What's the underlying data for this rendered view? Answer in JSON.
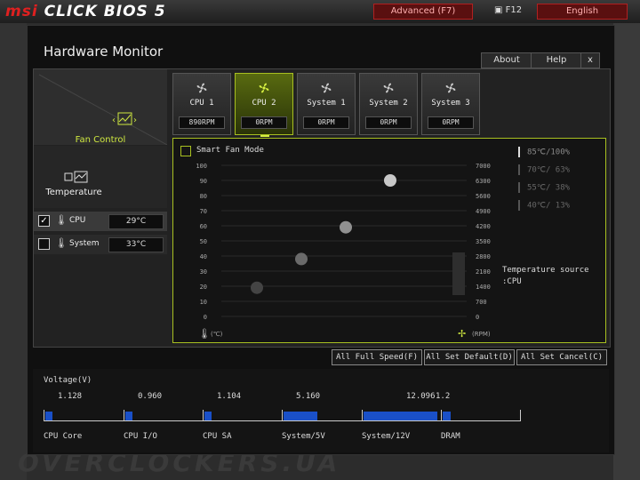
{
  "topbar": {
    "brand_msi": "msi",
    "brand_rest": "CLICK BIOS 5",
    "mode": "Advanced (F7)",
    "screenshot_key": "F12",
    "language": "English"
  },
  "window": {
    "title": "Hardware Monitor",
    "about": "About",
    "help": "Help",
    "close": "x"
  },
  "sidebar": {
    "fan_control_label": "Fan Control",
    "temperature_label": "Temperature",
    "sensors": [
      {
        "name": "CPU",
        "value": "29°C",
        "checked": true
      },
      {
        "name": "System",
        "value": "33°C",
        "checked": false
      }
    ]
  },
  "fans": [
    {
      "name": "CPU 1",
      "rpm": "890RPM",
      "selected": false
    },
    {
      "name": "CPU 2",
      "rpm": "0RPM",
      "selected": true
    },
    {
      "name": "System 1",
      "rpm": "0RPM",
      "selected": false
    },
    {
      "name": "System 2",
      "rpm": "0RPM",
      "selected": false
    },
    {
      "name": "System 3",
      "rpm": "0RPM",
      "selected": false
    }
  ],
  "graph": {
    "smart_fan_label": "Smart Fan Mode",
    "smart_fan_checked": false,
    "left_ticks": [
      "100",
      "90",
      "80",
      "70",
      "60",
      "50",
      "40",
      "30",
      "20",
      "10",
      "0"
    ],
    "right_ticks": [
      "7000",
      "6300",
      "5600",
      "4900",
      "4200",
      "3500",
      "2800",
      "2100",
      "1400",
      "700",
      "0"
    ],
    "left_unit": "(℃)",
    "right_unit": "(RPM)",
    "legend": [
      "85℃/100%",
      "70℃/ 63%",
      "55℃/ 38%",
      "40℃/ 13%"
    ],
    "temp_source_title": "Temperature source",
    "temp_source_value": ":CPU",
    "points": [
      {
        "temp": 40,
        "fan_pct": 19
      },
      {
        "temp": 55,
        "fan_pct": 38
      },
      {
        "temp": 70,
        "fan_pct": 59
      },
      {
        "temp": 85,
        "fan_pct": 90
      }
    ]
  },
  "actions": {
    "full_speed": "All Full Speed(F)",
    "set_default": "All Set Default(D)",
    "set_cancel": "All Set Cancel(C)"
  },
  "voltage": {
    "title": "Voltage(V)",
    "items": [
      {
        "name": "CPU Core",
        "value": "1.128",
        "level": 0.03
      },
      {
        "name": "CPU I/O",
        "value": "0.960",
        "level": 0.03
      },
      {
        "name": "CPU SA",
        "value": "1.104",
        "level": 0.03
      },
      {
        "name": "System/5V",
        "value": "5.160",
        "level": 0.42
      },
      {
        "name": "System/12V",
        "value": "12.096",
        "level": 0.93
      },
      {
        "name": "DRAM",
        "value": "1.2",
        "level": 0.1
      }
    ]
  },
  "watermark": "OVERCLOCKERS.UA",
  "colors": {
    "accent": "#a8c020",
    "alert": "#e02020",
    "voltage_bar": "#1a50c8"
  }
}
